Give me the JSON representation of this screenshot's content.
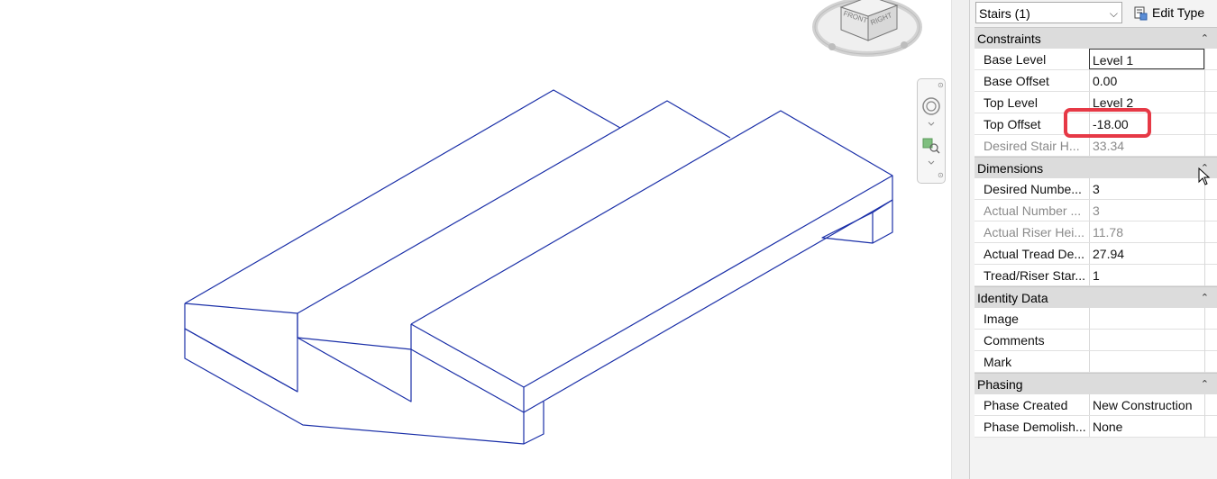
{
  "properties": {
    "type_selector": "Stairs (1)",
    "edit_type_label": "Edit Type",
    "categories": [
      {
        "name": "Constraints",
        "rows": [
          {
            "label": "Base Level",
            "value": "Level 1",
            "state": "editing"
          },
          {
            "label": "Base Offset",
            "value": "0.00",
            "state": "normal"
          },
          {
            "label": "Top Level",
            "value": "Level 2",
            "state": "normal"
          },
          {
            "label": "Top Offset",
            "value": "-18.00",
            "state": "highlighted"
          },
          {
            "label": "Desired Stair H...",
            "value": "33.34",
            "state": "disabled"
          }
        ]
      },
      {
        "name": "Dimensions",
        "rows": [
          {
            "label": "Desired Numbe...",
            "value": "3",
            "state": "normal"
          },
          {
            "label": "Actual Number ...",
            "value": "3",
            "state": "disabled"
          },
          {
            "label": "Actual Riser Hei...",
            "value": "11.78",
            "state": "disabled"
          },
          {
            "label": "Actual Tread De...",
            "value": "27.94",
            "state": "normal"
          },
          {
            "label": "Tread/Riser Star...",
            "value": "1",
            "state": "normal"
          }
        ]
      },
      {
        "name": "Identity Data",
        "rows": [
          {
            "label": "Image",
            "value": "",
            "state": "normal"
          },
          {
            "label": "Comments",
            "value": "",
            "state": "normal"
          },
          {
            "label": "Mark",
            "value": "",
            "state": "normal"
          }
        ]
      },
      {
        "name": "Phasing",
        "rows": [
          {
            "label": "Phase Created",
            "value": "New Construction",
            "state": "normal"
          },
          {
            "label": "Phase Demolish...",
            "value": "None",
            "state": "normal"
          }
        ]
      }
    ]
  },
  "viewcube": {
    "face_front": "FRONT",
    "face_right": "RIGHT"
  },
  "colors": {
    "model_lines": "#1a2fa8",
    "highlight": "#e63946",
    "category_bg": "#dcdcdc"
  },
  "icons": [
    "edit-type-icon",
    "collapse-icon",
    "steering-wheel-icon",
    "zoom-region-icon",
    "chevron-down-icon",
    "mouse-cursor-icon"
  ]
}
